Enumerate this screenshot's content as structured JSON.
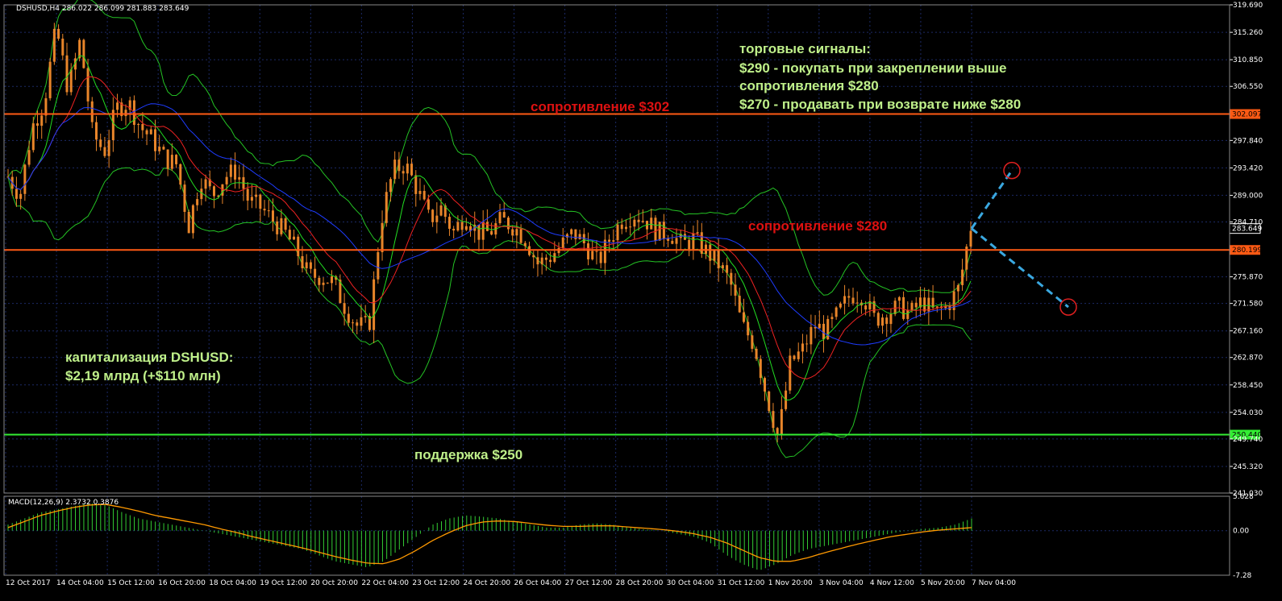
{
  "main_header": "DSHUSD,H4  286.022 286.099 281.883 283.649",
  "macd_header": "MACD(12,26,9) 2.3732 0.3876",
  "colors": {
    "background": "#000000",
    "grid": "#1c2a66",
    "frame": "#888888",
    "candle": "#e8852a",
    "bollinger": "#24c224",
    "ma_fast": "#22dd22",
    "ma_mid": "#ee2222",
    "ma_slow": "#1e3cff",
    "resistance": "#ff5a14",
    "support": "#33ee33",
    "annotation_green": "#bff08a",
    "annotation_red": "#dd1111",
    "forecast": "#3aa8e0",
    "macd_hist": "#33cc33",
    "macd_signal": "#ff9900"
  },
  "annotations": {
    "signals_title": "торговые сигналы:",
    "signals_line1": "$290 - покупать при закреплении выше",
    "signals_line2": "сопротивления $280",
    "signals_line3": "$270 - продавать при возврате ниже $280",
    "resistance_302": "сопротивление $302",
    "resistance_280": "сопротивление $280",
    "support_250": "поддержка $250",
    "cap_line1": "капитализация DSHUSD:",
    "cap_line2": "$2,19 млрд (+$110 млн)"
  },
  "chart_data": [
    {
      "type": "candlestick",
      "symbol": "DSHUSD",
      "timeframe": "H4",
      "ohlc_current": {
        "open": 286.022,
        "high": 286.099,
        "low": 281.883,
        "close": 283.649
      },
      "x_ticks": [
        "12 Oct 2017",
        "14 Oct 04:00",
        "15 Oct 12:00",
        "16 Oct 20:00",
        "18 Oct 04:00",
        "19 Oct 12:00",
        "20 Oct 20:00",
        "22 Oct 04:00",
        "23 Oct 12:00",
        "24 Oct 20:00",
        "26 Oct 04:00",
        "27 Oct 12:00",
        "28 Oct 20:00",
        "30 Oct 04:00",
        "31 Oct 12:00",
        "1 Nov 20:00",
        "3 Nov 04:00",
        "4 Nov 12:00",
        "5 Nov 20:00",
        "7 Nov 04:00"
      ],
      "y_ticks": [
        "319.690",
        "315.260",
        "310.850",
        "306.550",
        "297.840",
        "293.420",
        "289.000",
        "284.710",
        "275.870",
        "271.580",
        "267.160",
        "262.870",
        "258.450",
        "254.030",
        "249.740",
        "245.320",
        "241.030"
      ],
      "ylim": [
        241.03,
        319.69
      ],
      "price_markers": [
        "302.097",
        "283.649",
        "280.199",
        "250.440"
      ],
      "levels": [
        {
          "name": "resistance",
          "value": 302.097
        },
        {
          "name": "resistance",
          "value": 280.199
        },
        {
          "name": "support",
          "value": 250.44
        }
      ],
      "close_path": [
        292,
        289,
        300,
        304,
        316,
        306,
        314,
        299,
        296,
        303,
        304,
        300,
        298,
        295,
        294,
        284,
        292,
        289,
        292,
        293,
        288,
        287,
        285,
        283,
        280,
        276,
        276,
        275,
        271,
        268,
        268,
        285,
        293,
        294,
        290,
        285,
        287,
        283,
        286,
        283,
        283,
        285,
        284,
        282,
        278,
        279,
        281,
        283,
        281,
        278,
        282,
        285,
        286,
        285,
        283,
        283,
        281,
        282,
        280,
        278,
        275,
        268,
        265,
        257,
        250,
        262,
        264,
        268,
        267,
        270,
        273,
        273,
        269,
        270,
        271,
        270,
        272,
        270,
        271,
        274,
        284
      ],
      "forecast": [
        {
          "step": "up",
          "from": 283.649,
          "to": 293.0
        },
        {
          "step": "down",
          "from": 283.649,
          "to": 271.0
        }
      ]
    },
    {
      "type": "macd",
      "params": "12,26,9",
      "main": 2.3732,
      "signal": 0.3876,
      "y_ticks": [
        "5.628",
        "0.00",
        "-7.28"
      ],
      "ylim": [
        -7.28,
        5.628
      ],
      "histogram_path": [
        1,
        2,
        3,
        3.5,
        4,
        4.5,
        4.2,
        3,
        2,
        1.5,
        1,
        0.5,
        0,
        -0.5,
        -1,
        -1.5,
        -2,
        -2.5,
        -3,
        -4,
        -5,
        -5.5,
        -6,
        -5,
        -3,
        -1,
        1,
        2,
        2.5,
        2.3,
        2,
        1.5,
        1,
        0.5,
        0.5,
        1,
        1.2,
        1,
        0.5,
        0.2,
        0,
        -0.5,
        -1,
        -2,
        -4,
        -5.5,
        -6.5,
        -5.5,
        -4,
        -3,
        -2.5,
        -2,
        -1.5,
        -1,
        -0.5,
        0,
        0.3,
        0.5,
        1,
        2
      ],
      "signal_path": [
        0.5,
        1.5,
        2.5,
        3.2,
        3.8,
        4.2,
        4.3,
        3.8,
        3.2,
        2.5,
        2,
        1.5,
        1,
        0.3,
        -0.3,
        -1,
        -1.6,
        -2.2,
        -2.8,
        -3.5,
        -4.2,
        -4.8,
        -5.3,
        -5.4,
        -4.6,
        -3.2,
        -1.6,
        -0.3,
        0.8,
        1.4,
        1.6,
        1.5,
        1.2,
        0.9,
        0.7,
        0.7,
        0.8,
        0.8,
        0.6,
        0.4,
        0.2,
        -0.1,
        -0.5,
        -1.1,
        -2,
        -3.2,
        -4.4,
        -5,
        -5,
        -4.4,
        -3.6,
        -2.9,
        -2.2,
        -1.6,
        -1,
        -0.6,
        -0.2,
        0.1,
        0.3,
        0.5
      ]
    }
  ]
}
